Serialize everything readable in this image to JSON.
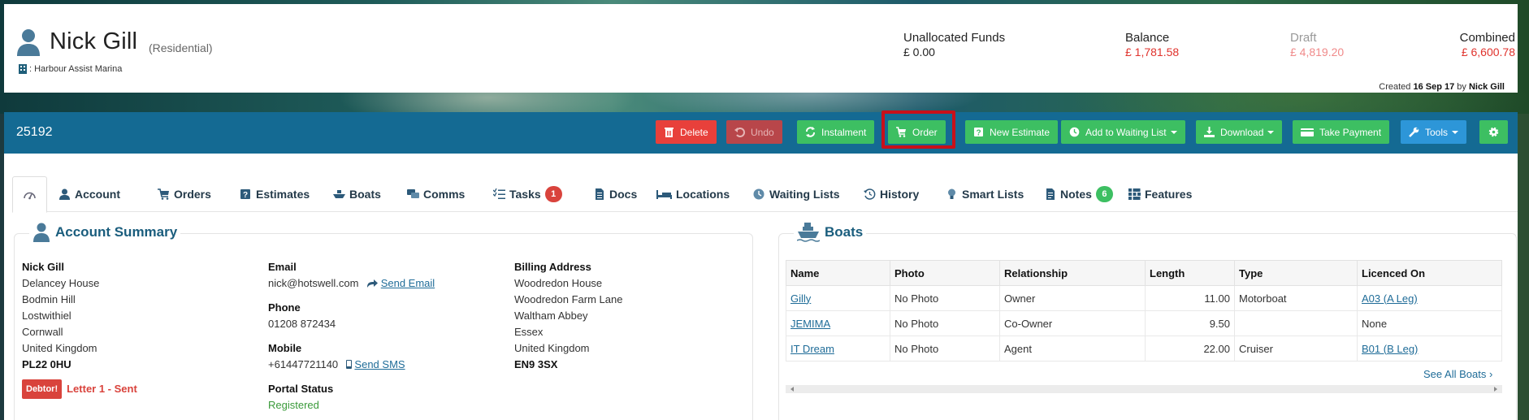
{
  "customer": {
    "name": "Nick Gill",
    "type": "(Residential)",
    "marina": ": Harbour Assist Marina"
  },
  "funds": {
    "unallocated_label": "Unallocated Funds",
    "unallocated_value": "£ 0.00",
    "balance_label": "Balance",
    "balance_value": "£ 1,781.58",
    "draft_label": "Draft",
    "draft_value": "£ 4,819.20",
    "combined_label": "Combined",
    "combined_value": "£ 6,600.78"
  },
  "created": {
    "prefix": "Created",
    "date": "16 Sep 17",
    "by": "by",
    "user": "Nick Gill"
  },
  "toolbar": {
    "record_id": "25192",
    "delete": "Delete",
    "undo": "Undo",
    "instalment": "Instalment",
    "order": "Order",
    "new_estimate": "New Estimate",
    "add_waiting_list": "Add to Waiting List",
    "download": "Download",
    "take_payment": "Take Payment",
    "tools": "Tools"
  },
  "tabs": [
    {
      "label": "Account"
    },
    {
      "label": "Orders"
    },
    {
      "label": "Estimates"
    },
    {
      "label": "Boats"
    },
    {
      "label": "Comms"
    },
    {
      "label": "Tasks",
      "badge": "1"
    },
    {
      "label": "Docs"
    },
    {
      "label": "Locations"
    },
    {
      "label": "Waiting Lists"
    },
    {
      "label": "History"
    },
    {
      "label": "Smart Lists"
    },
    {
      "label": "Notes",
      "badge": "6"
    },
    {
      "label": "Features"
    }
  ],
  "account_summary": {
    "title": "Account Summary",
    "address": {
      "name": "Nick Gill",
      "lines": [
        "Delancey House",
        "Bodmin Hill",
        "Lostwithiel",
        "Cornwall",
        "United Kingdom"
      ],
      "postcode": "PL22 0HU"
    },
    "debtor_badge": "Debtor!",
    "letter_status": "Letter 1 - Sent",
    "email_label": "Email",
    "email": "nick@hotswell.com",
    "send_email": "Send Email",
    "phone_label": "Phone",
    "phone": "01208 872434",
    "mobile_label": "Mobile",
    "mobile": "+61447721140",
    "send_sms": "Send SMS",
    "portal_label": "Portal Status",
    "portal_value": "Registered",
    "billing_label": "Billing Address",
    "billing_lines": [
      "Woodredon House",
      "Woodredon Farm Lane",
      "Waltham Abbey",
      "Essex",
      "United Kingdom"
    ],
    "billing_postcode": "EN9 3SX"
  },
  "boats_panel": {
    "title": "Boats",
    "columns": [
      "Name",
      "Photo",
      "Relationship",
      "Length",
      "Type",
      "Licenced On"
    ],
    "rows": [
      {
        "name": "Gilly",
        "photo": "No Photo",
        "relationship": "Owner",
        "length": "11.00",
        "type": "Motorboat",
        "licenced": "A03 (A Leg)"
      },
      {
        "name": "JEMIMA",
        "photo": "No Photo",
        "relationship": "Co-Owner",
        "length": "9.50",
        "type": "",
        "licenced": "None"
      },
      {
        "name": "IT Dream",
        "photo": "No Photo",
        "relationship": "Agent",
        "length": "22.00",
        "type": "Cruiser",
        "licenced": "B01 (B Leg)"
      }
    ],
    "see_all": "See All Boats"
  }
}
